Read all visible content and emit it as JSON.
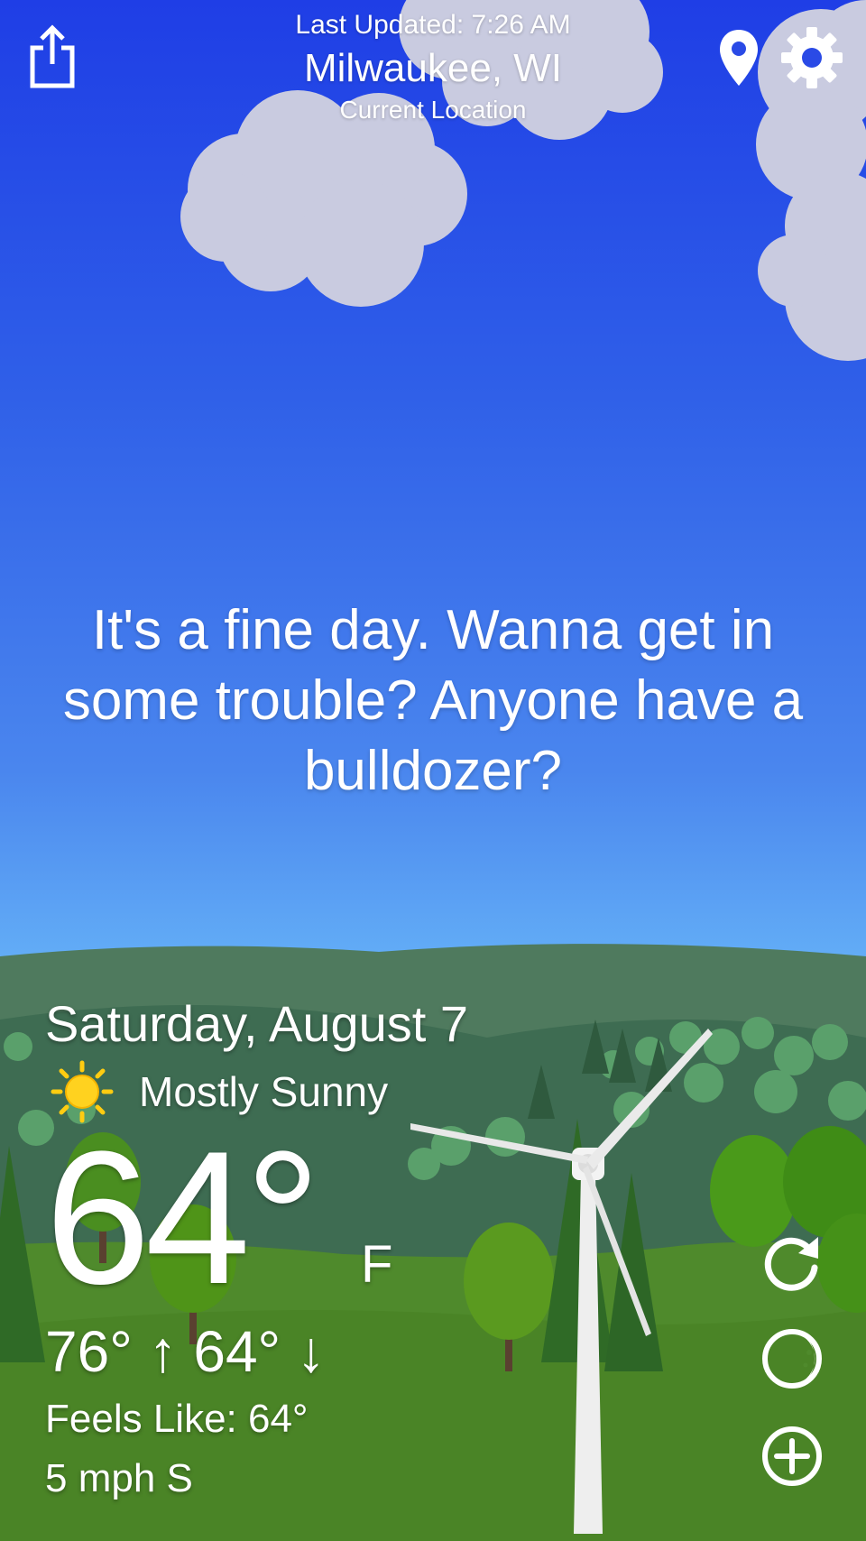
{
  "header": {
    "last_updated": "Last Updated: 7:26 AM",
    "location": "Milwaukee, WI",
    "location_sub": "Current Location"
  },
  "message": "It's a fine day. Wanna get in some trouble? Anyone have a bulldozer?",
  "weather": {
    "date": "Saturday, August 7",
    "condition": "Mostly Sunny",
    "condition_icon": "sun-icon",
    "temperature": "64°",
    "unit": "F",
    "high_low": "76° ↑ 64° ↓",
    "feels_like": "Feels Like: 64°",
    "wind": "5 mph S"
  },
  "icons": {
    "share": "share-icon",
    "location": "location-pin-icon",
    "settings": "gear-icon",
    "refresh": "refresh-icon",
    "moon": "moon-icon",
    "add": "add-circle-icon"
  },
  "colors": {
    "sky_top": "#1f3ee6",
    "sky_bottom": "#6dbdf8",
    "hill_dark": "#3d6e52",
    "grass": "#4f8a2c",
    "cloud": "#c9cce0",
    "sun": "#ffd21f"
  }
}
